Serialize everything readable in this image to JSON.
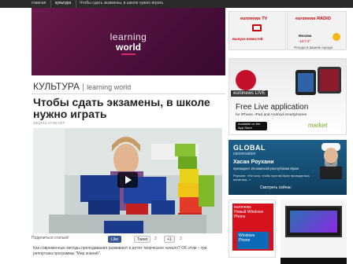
{
  "nav": {
    "home": "главная",
    "culture": "культура",
    "current": "Чтобы сдать экзамены, в школе нужно играть"
  },
  "banner": {
    "line1": "learning",
    "line2": "world"
  },
  "article": {
    "section": "КУЛЬТУРА",
    "subsection": "learning world",
    "headline": "Чтобы сдать экзамены, в школе нужно играть",
    "date": "20/12/13 17:30 CET",
    "share_label": "Поделиться статьей",
    "like_label": "Like",
    "tweet_label": "Tweet",
    "tweet_count": "2",
    "plus_label": "+1",
    "plus_count": "3",
    "description": "Как современные методы преподавания развивают в детях творческое начало? Об этом – три репортажа программы \"Мир знаний\"."
  },
  "sidebar": {
    "tv": {
      "title": "euronews TV",
      "link": "выпуск новостей"
    },
    "radio": {
      "title": "euronews RADIO",
      "city": "Москва",
      "temp": "-16°/-3°",
      "small": "Погода в вашем городе"
    },
    "ad_live": {
      "brand": "euronews LIVE",
      "tagline": "Free Live application",
      "sub": "for iPhone, iPad and Android smartphones",
      "store": "Available on the App Store",
      "market": "market"
    },
    "ad_global": {
      "title": "GLOBAL",
      "title2": "conversation",
      "name": "Хасан Роухани",
      "role": "президент Исламской республики Иран",
      "quote": "Роухани: «Ни хочу, чтобы против Иран проводилась политика...»",
      "watch": "Смотреть сейчас"
    },
    "ad_windows": {
      "brand": "euronews",
      "text": "Новый Windows Phone",
      "win": "Windows Phone"
    }
  },
  "colors": {
    "banner": "#5a1344",
    "accent": "#d9286e",
    "brand_red": "#c4102a"
  }
}
